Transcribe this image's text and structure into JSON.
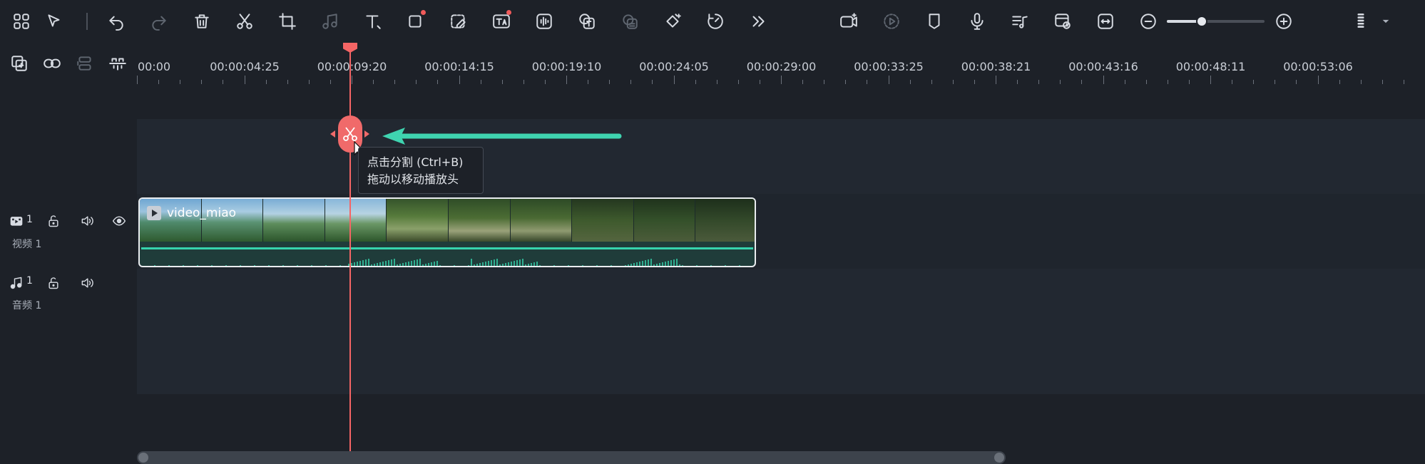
{
  "ruler": {
    "labels": [
      "00:00",
      "00:00:04:25",
      "00:00:09:20",
      "00:00:14:15",
      "00:00:19:10",
      "00:00:24:05",
      "00:00:29:00",
      "00:00:33:25",
      "00:00:38:21",
      "00:00:43:16",
      "00:00:48:11",
      "00:00:53:06"
    ]
  },
  "tooltip": {
    "line1": "点击分割 (Ctrl+B)",
    "line2": "拖动以移动播放头"
  },
  "tracks": {
    "video": {
      "number": "1",
      "name": "视频 1"
    },
    "audio": {
      "number": "1",
      "name": "音频 1"
    }
  },
  "clip": {
    "title": "video_miao"
  },
  "zoom": {
    "level": 0.36
  },
  "colors": {
    "playhead": "#f56565",
    "accent": "#36d3ad",
    "background": "#1d2128"
  }
}
